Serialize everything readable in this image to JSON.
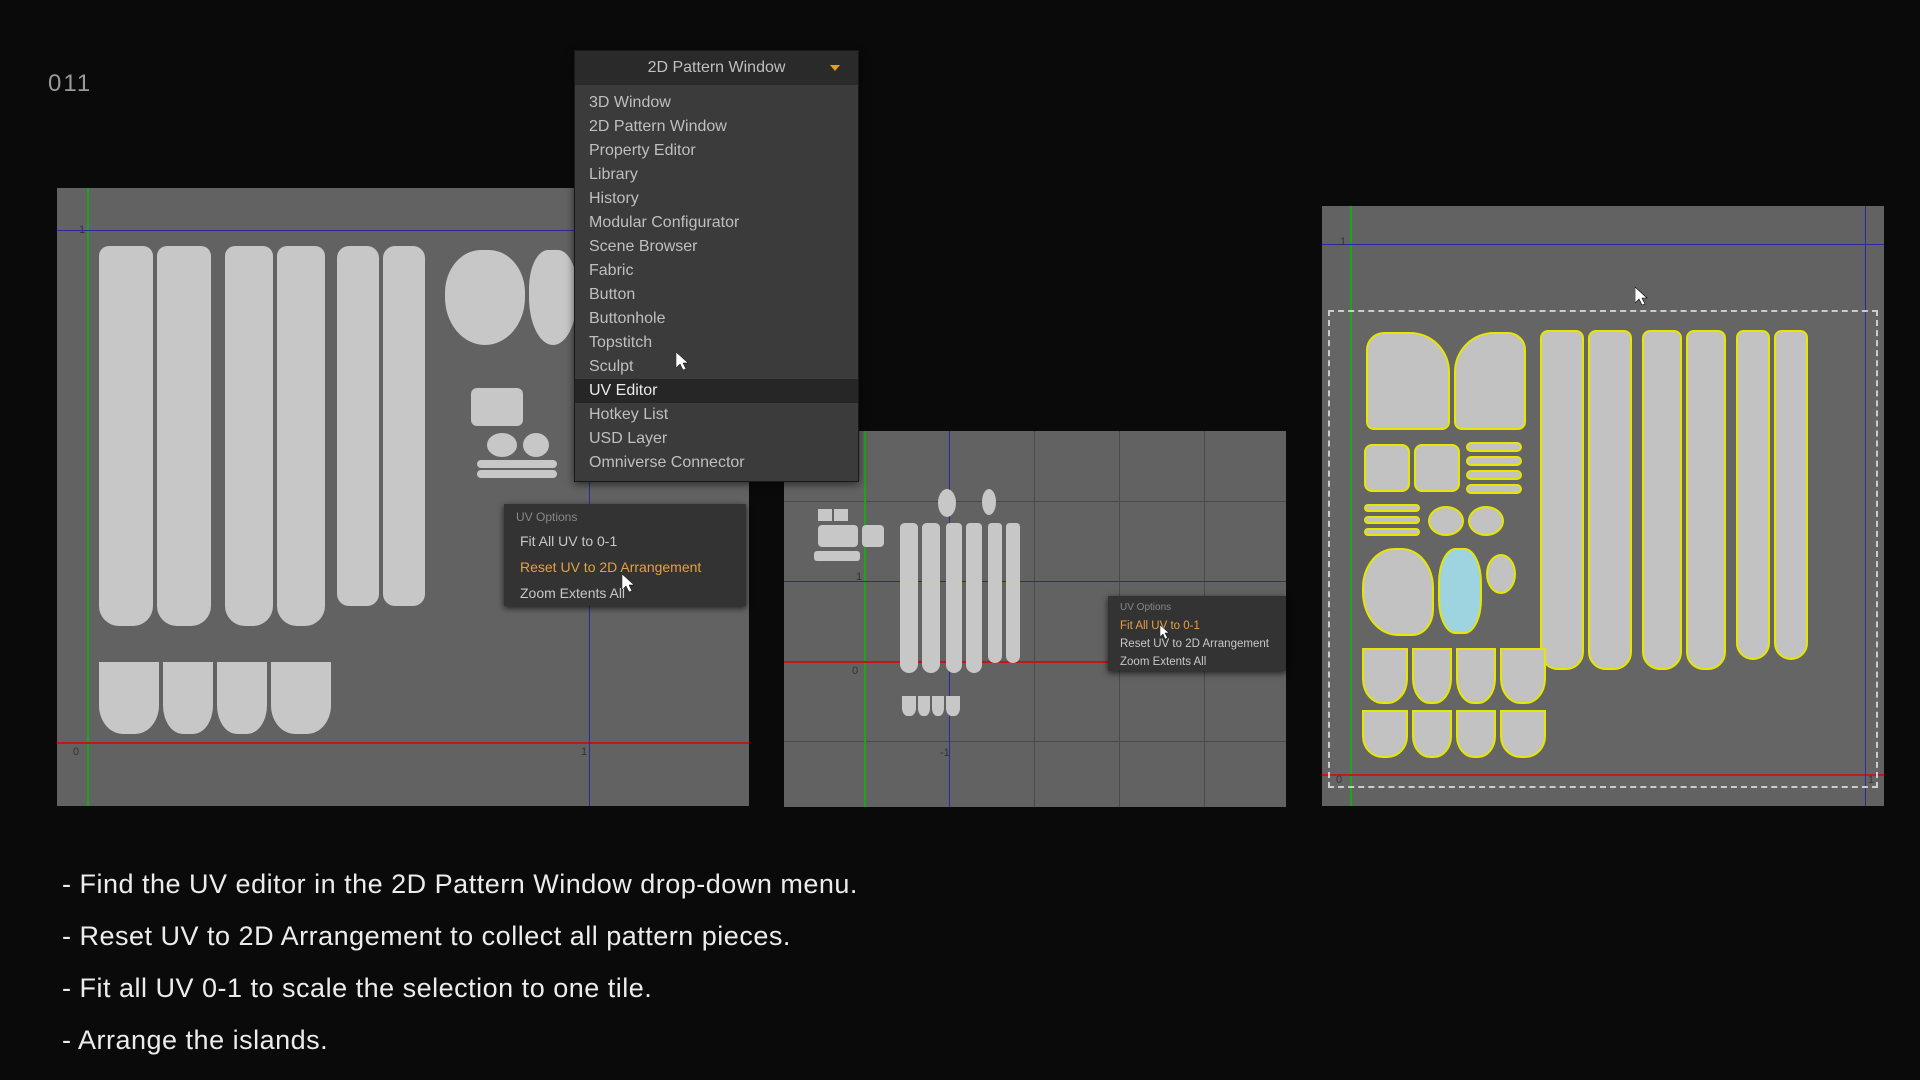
{
  "page_number": "011",
  "dropdown": {
    "header": "2D Pattern Window",
    "items": [
      "3D Window",
      "2D Pattern Window",
      "Property Editor",
      "Library",
      "History",
      "Modular Configurator",
      "Scene Browser",
      "Fabric",
      "Button",
      "Buttonhole",
      "Topstitch",
      "Sculpt",
      "UV Editor",
      "Hotkey List",
      "USD Layer",
      "Omniverse Connector"
    ],
    "highlighted_index": 12
  },
  "ctx_left": {
    "title": "UV Options",
    "items": [
      "Fit All UV to 0-1",
      "Reset UV to 2D Arrangement",
      "Zoom Extents All"
    ],
    "highlighted_index": 1
  },
  "ctx_mid": {
    "title": "UV Options",
    "items": [
      "Fit All UV to 0-1",
      "Reset UV to 2D Arrangement",
      "Zoom Extents All"
    ],
    "highlighted_index": 0
  },
  "ticks": {
    "zero": "0",
    "one": "1",
    "minus_one": "-1"
  },
  "instructions": [
    "- Find the UV editor in the 2D Pattern Window drop-down menu.",
    "- Reset UV to 2D Arrangement to collect all pattern pieces.",
    "- Fit all UV 0-1 to scale the selection to one tile.",
    "- Arrange the islands."
  ]
}
